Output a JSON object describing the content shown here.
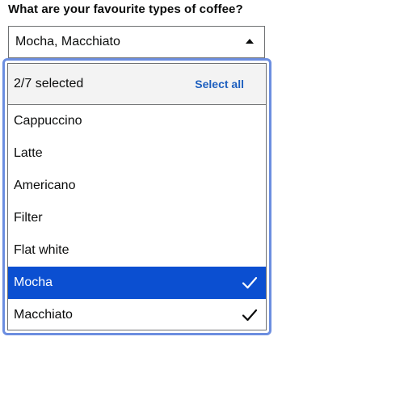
{
  "question": "What are your favourite types of coffee?",
  "select": {
    "value": "Mocha, Macchiato",
    "icon": "caret-up-icon"
  },
  "listbox": {
    "count_text": "2/7 selected",
    "select_all_label": "Select all",
    "options": [
      {
        "label": "Cappuccino",
        "selected": false
      },
      {
        "label": "Latte",
        "selected": false
      },
      {
        "label": "Americano",
        "selected": false
      },
      {
        "label": "Filter",
        "selected": false
      },
      {
        "label": "Flat white",
        "selected": false
      },
      {
        "label": "Mocha",
        "selected": true
      },
      {
        "label": "Macchiato",
        "selected": true
      }
    ],
    "active_option": "Mocha"
  },
  "colors": {
    "accent": "#0b4fd1",
    "link": "#1d5fbf",
    "focus_ring": "#6c8ee0",
    "header_bg": "#f3f3f3"
  }
}
